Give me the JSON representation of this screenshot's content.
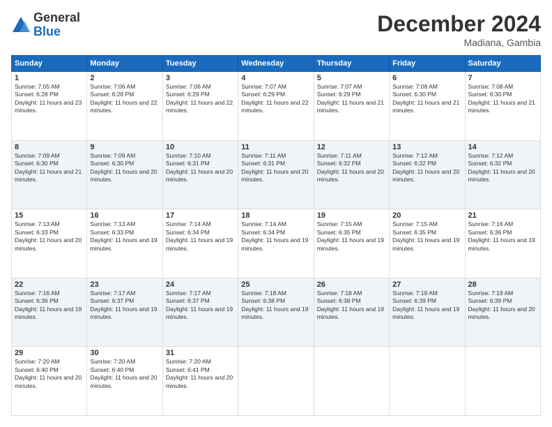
{
  "logo": {
    "general": "General",
    "blue": "Blue"
  },
  "title": "December 2024",
  "location": "Madiana, Gambia",
  "days_header": [
    "Sunday",
    "Monday",
    "Tuesday",
    "Wednesday",
    "Thursday",
    "Friday",
    "Saturday"
  ],
  "weeks": [
    [
      {
        "day": "1",
        "sunrise": "7:05 AM",
        "sunset": "6:28 PM",
        "daylight": "11 hours and 23 minutes."
      },
      {
        "day": "2",
        "sunrise": "7:06 AM",
        "sunset": "6:28 PM",
        "daylight": "11 hours and 22 minutes."
      },
      {
        "day": "3",
        "sunrise": "7:06 AM",
        "sunset": "6:29 PM",
        "daylight": "11 hours and 22 minutes."
      },
      {
        "day": "4",
        "sunrise": "7:07 AM",
        "sunset": "6:29 PM",
        "daylight": "11 hours and 22 minutes."
      },
      {
        "day": "5",
        "sunrise": "7:07 AM",
        "sunset": "6:29 PM",
        "daylight": "11 hours and 21 minutes."
      },
      {
        "day": "6",
        "sunrise": "7:08 AM",
        "sunset": "6:30 PM",
        "daylight": "11 hours and 21 minutes."
      },
      {
        "day": "7",
        "sunrise": "7:08 AM",
        "sunset": "6:30 PM",
        "daylight": "11 hours and 21 minutes."
      }
    ],
    [
      {
        "day": "8",
        "sunrise": "7:09 AM",
        "sunset": "6:30 PM",
        "daylight": "11 hours and 21 minutes."
      },
      {
        "day": "9",
        "sunrise": "7:09 AM",
        "sunset": "6:30 PM",
        "daylight": "11 hours and 20 minutes."
      },
      {
        "day": "10",
        "sunrise": "7:10 AM",
        "sunset": "6:31 PM",
        "daylight": "11 hours and 20 minutes."
      },
      {
        "day": "11",
        "sunrise": "7:11 AM",
        "sunset": "6:31 PM",
        "daylight": "11 hours and 20 minutes."
      },
      {
        "day": "12",
        "sunrise": "7:11 AM",
        "sunset": "6:32 PM",
        "daylight": "11 hours and 20 minutes."
      },
      {
        "day": "13",
        "sunrise": "7:12 AM",
        "sunset": "6:32 PM",
        "daylight": "11 hours and 20 minutes."
      },
      {
        "day": "14",
        "sunrise": "7:12 AM",
        "sunset": "6:32 PM",
        "daylight": "11 hours and 20 minutes."
      }
    ],
    [
      {
        "day": "15",
        "sunrise": "7:13 AM",
        "sunset": "6:33 PM",
        "daylight": "11 hours and 20 minutes."
      },
      {
        "day": "16",
        "sunrise": "7:13 AM",
        "sunset": "6:33 PM",
        "daylight": "11 hours and 19 minutes."
      },
      {
        "day": "17",
        "sunrise": "7:14 AM",
        "sunset": "6:34 PM",
        "daylight": "11 hours and 19 minutes."
      },
      {
        "day": "18",
        "sunrise": "7:14 AM",
        "sunset": "6:34 PM",
        "daylight": "11 hours and 19 minutes."
      },
      {
        "day": "19",
        "sunrise": "7:15 AM",
        "sunset": "6:35 PM",
        "daylight": "11 hours and 19 minutes."
      },
      {
        "day": "20",
        "sunrise": "7:15 AM",
        "sunset": "6:35 PM",
        "daylight": "11 hours and 19 minutes."
      },
      {
        "day": "21",
        "sunrise": "7:16 AM",
        "sunset": "6:36 PM",
        "daylight": "11 hours and 19 minutes."
      }
    ],
    [
      {
        "day": "22",
        "sunrise": "7:16 AM",
        "sunset": "6:36 PM",
        "daylight": "11 hours and 19 minutes."
      },
      {
        "day": "23",
        "sunrise": "7:17 AM",
        "sunset": "6:37 PM",
        "daylight": "11 hours and 19 minutes."
      },
      {
        "day": "24",
        "sunrise": "7:17 AM",
        "sunset": "6:37 PM",
        "daylight": "11 hours and 19 minutes."
      },
      {
        "day": "25",
        "sunrise": "7:18 AM",
        "sunset": "6:38 PM",
        "daylight": "11 hours and 19 minutes."
      },
      {
        "day": "26",
        "sunrise": "7:18 AM",
        "sunset": "6:38 PM",
        "daylight": "11 hours and 19 minutes."
      },
      {
        "day": "27",
        "sunrise": "7:19 AM",
        "sunset": "6:39 PM",
        "daylight": "11 hours and 19 minutes."
      },
      {
        "day": "28",
        "sunrise": "7:19 AM",
        "sunset": "6:39 PM",
        "daylight": "11 hours and 20 minutes."
      }
    ],
    [
      {
        "day": "29",
        "sunrise": "7:20 AM",
        "sunset": "6:40 PM",
        "daylight": "11 hours and 20 minutes."
      },
      {
        "day": "30",
        "sunrise": "7:20 AM",
        "sunset": "6:40 PM",
        "daylight": "11 hours and 20 minutes."
      },
      {
        "day": "31",
        "sunrise": "7:20 AM",
        "sunset": "6:41 PM",
        "daylight": "11 hours and 20 minutes."
      },
      null,
      null,
      null,
      null
    ]
  ]
}
